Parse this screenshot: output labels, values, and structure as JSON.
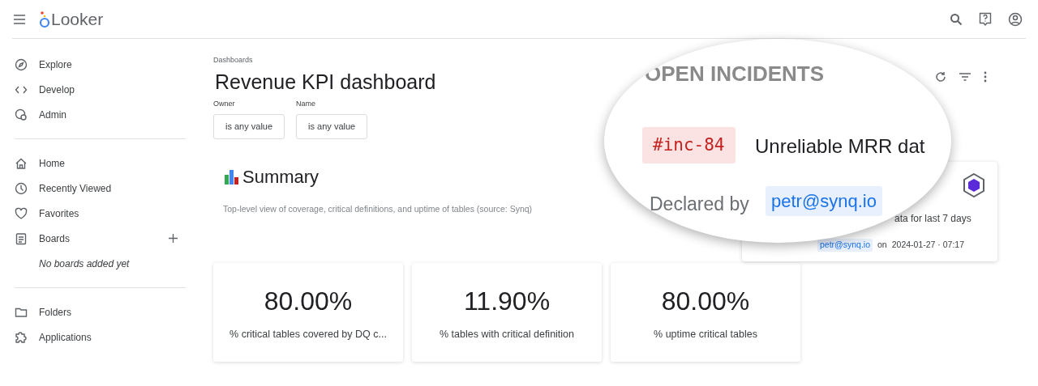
{
  "header": {
    "logo": "Looker"
  },
  "sidebar": {
    "groups": [
      {
        "items": [
          {
            "label": "Explore"
          },
          {
            "label": "Develop"
          },
          {
            "label": "Admin"
          }
        ]
      },
      {
        "items": [
          {
            "label": "Home"
          },
          {
            "label": "Recently Viewed"
          },
          {
            "label": "Favorites"
          },
          {
            "label": "Boards",
            "add": true
          }
        ],
        "note": "No boards added yet"
      },
      {
        "items": [
          {
            "label": "Folders"
          },
          {
            "label": "Applications"
          }
        ]
      }
    ]
  },
  "dashboard": {
    "breadcrumb": "Dashboards",
    "title": "Revenue KPI dashboard",
    "filters": [
      {
        "label": "Owner",
        "value": "is any value"
      },
      {
        "label": "Name",
        "value": "is any value"
      }
    ],
    "summary": {
      "title": "Summary",
      "description": "Top-level view of coverage, critical definitions, and uptime of tables (source: Synq)"
    },
    "tiles": [
      {
        "value": "80.00%",
        "label": "% critical tables covered by DQ c..."
      },
      {
        "value": "11.90%",
        "label": "% tables with critical definition"
      },
      {
        "value": "80.00%",
        "label": "% uptime critical tables"
      }
    ],
    "incident_card": {
      "line_1": "ata for last 7 days",
      "user": "petr@synq.io",
      "on": "on",
      "date": "2024-01-27 · 07:17"
    }
  },
  "magnifier": {
    "heading": "OPEN INCIDENTS",
    "tag": "#inc-84",
    "title": "Unreliable MRR dat",
    "declared": "Declared by",
    "user": "petr@synq.io"
  }
}
